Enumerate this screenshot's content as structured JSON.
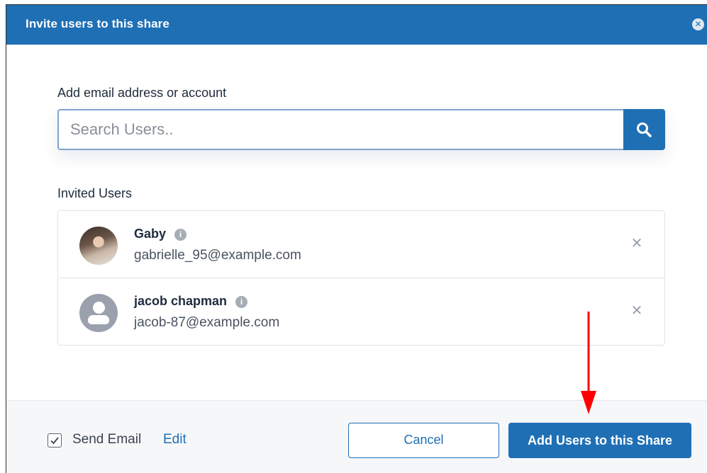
{
  "dialog": {
    "title": "Invite users to this share",
    "close_icon": "close-circle-icon"
  },
  "search": {
    "label": "Add email address or account",
    "placeholder": "Search Users..",
    "button_icon": "search-icon"
  },
  "invited": {
    "label": "Invited Users",
    "users": [
      {
        "name": "Gaby",
        "email": "gabrielle_95@example.com",
        "avatar": "photo"
      },
      {
        "name": "jacob chapman",
        "email": "jacob-87@example.com",
        "avatar": "generic-user-icon"
      }
    ]
  },
  "footer": {
    "send_email_label": "Send Email",
    "send_email_checked": true,
    "edit_label": "Edit",
    "cancel_label": "Cancel",
    "add_label": "Add Users to this Share"
  },
  "colors": {
    "primary": "#1f6fb4",
    "annotation": "#ff0000"
  }
}
